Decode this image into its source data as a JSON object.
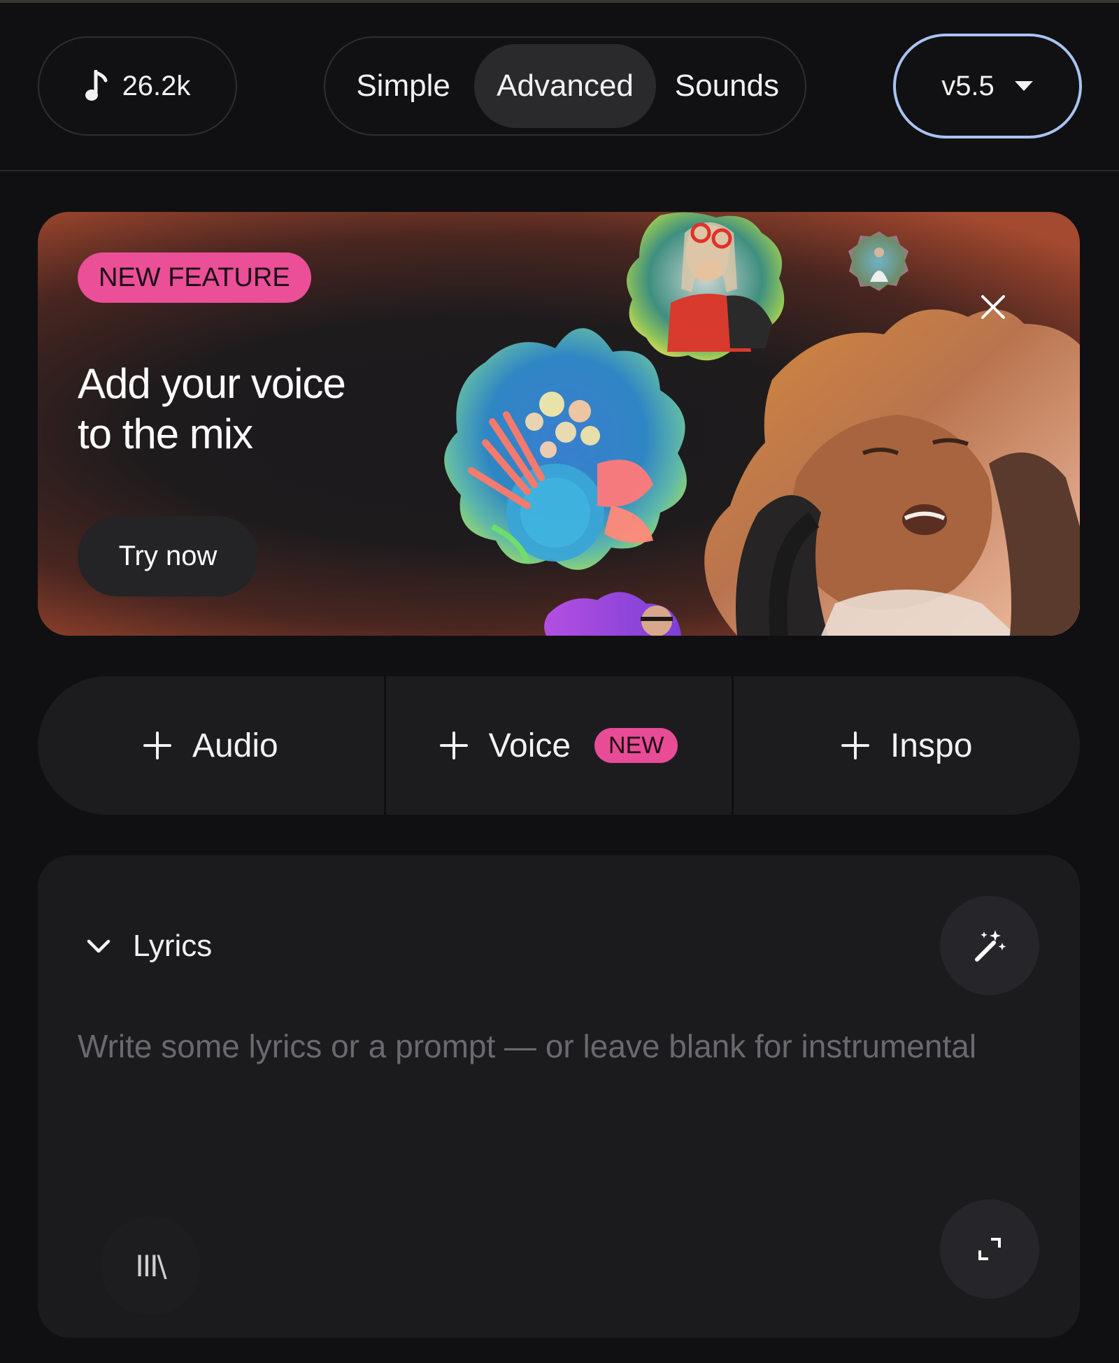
{
  "header": {
    "credits": "26.2k",
    "modes": [
      "Simple",
      "Advanced",
      "Sounds"
    ],
    "active_mode": "Advanced",
    "version": "v5.5"
  },
  "banner": {
    "badge": "NEW FEATURE",
    "title_line1": "Add your voice",
    "title_line2": "to the mix",
    "cta": "Try now"
  },
  "attachments": [
    {
      "label": "Audio"
    },
    {
      "label": "Voice",
      "badge": "NEW"
    },
    {
      "label": "Inspo"
    }
  ],
  "lyrics": {
    "label": "Lyrics",
    "placeholder": "Write some lyrics or a prompt — or leave blank for instrumental",
    "value": "",
    "library_glyph": "III\\"
  },
  "colors": {
    "background": "#101012",
    "accent_pink": "#ea4f98",
    "version_outline": "#a9c3f2",
    "banner_edge": "#a34a30"
  },
  "icons": [
    "music-note-icon",
    "caret-down-icon",
    "close-icon",
    "plus-icon",
    "chevron-down-icon",
    "magic-wand-icon",
    "library-icon",
    "expand-icon"
  ]
}
